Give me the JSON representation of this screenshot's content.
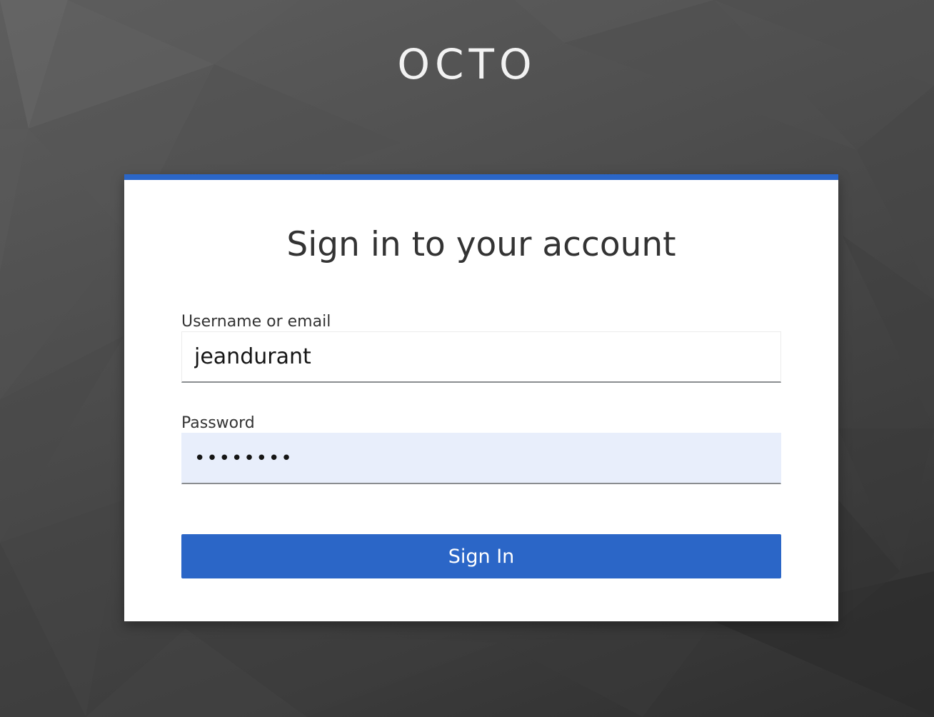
{
  "brand": {
    "name": "OCTO"
  },
  "login": {
    "title": "Sign in to your account",
    "username_label": "Username or email",
    "username_value": "jeandurant",
    "password_label": "Password",
    "password_value": "••••••••",
    "submit_label": "Sign In"
  },
  "colors": {
    "accent": "#2b66c7",
    "autofill_background": "#e8eefb",
    "card_background": "#ffffff",
    "page_background": "#4a4a4a"
  }
}
